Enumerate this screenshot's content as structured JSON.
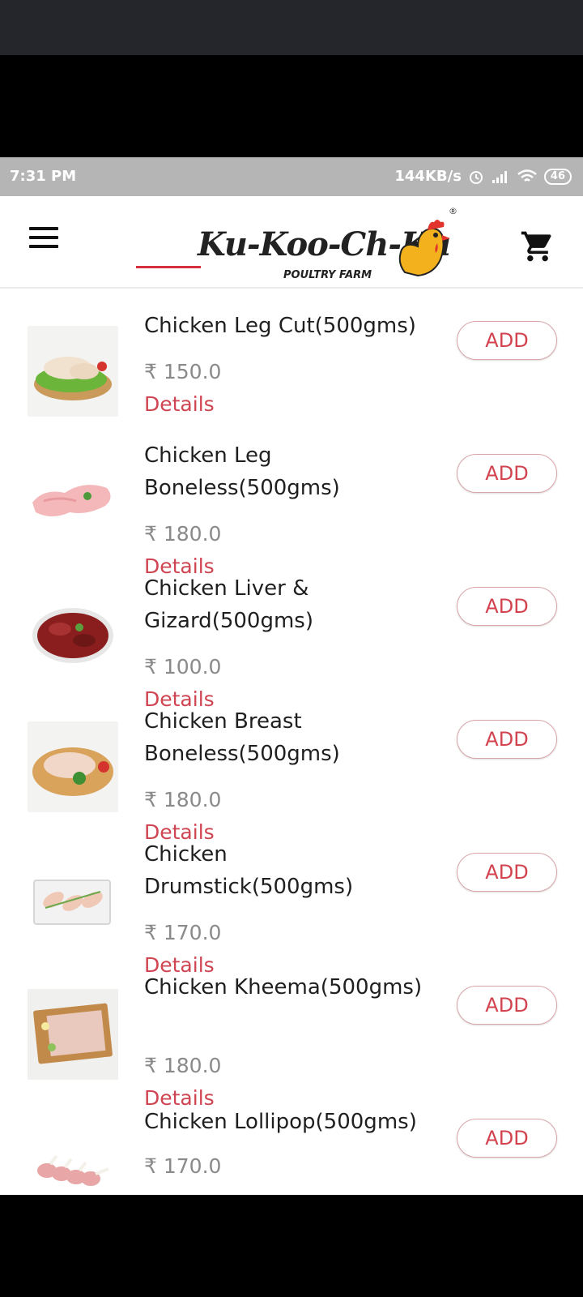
{
  "status_bar": {
    "time": "7:31 PM",
    "net_speed": "144KB/s",
    "battery": "46"
  },
  "header": {
    "logo_brand": "Ku-Koo-Ch-Ku",
    "logo_sub": "POULTRY FARM",
    "logo_reg": "®"
  },
  "products": [
    {
      "name": "Chicken Leg Cut(500gms)",
      "price": "₹ 150.0",
      "details": "Details",
      "add": "ADD"
    },
    {
      "name": "Chicken Leg Boneless(500gms)",
      "price": "₹ 180.0",
      "details": "Details",
      "add": "ADD"
    },
    {
      "name": "Chicken Liver & Gizard(500gms)",
      "price": "₹ 100.0",
      "details": "Details",
      "add": "ADD"
    },
    {
      "name": "Chicken Breast Boneless(500gms)",
      "price": "₹ 180.0",
      "details": "Details",
      "add": "ADD"
    },
    {
      "name": "Chicken Drumstick(500gms)",
      "price": "₹ 170.0",
      "details": "Details",
      "add": "ADD"
    },
    {
      "name": "Chicken Kheema(500gms)",
      "price": "₹ 180.0",
      "details": "Details",
      "add": "ADD"
    },
    {
      "name": "Chicken Lollipop(500gms)",
      "price": "₹ 170.0",
      "add": "ADD"
    }
  ],
  "colors": {
    "accent": "#cf4552",
    "status_bar": "#b5b5b5",
    "top_bar": "#25262b"
  },
  "icons": {
    "menu": "hamburger-menu-icon",
    "cart": "shopping-cart-icon",
    "wifi": "wifi-icon",
    "signal": "signal-icon",
    "alarm": "alarm-icon"
  }
}
